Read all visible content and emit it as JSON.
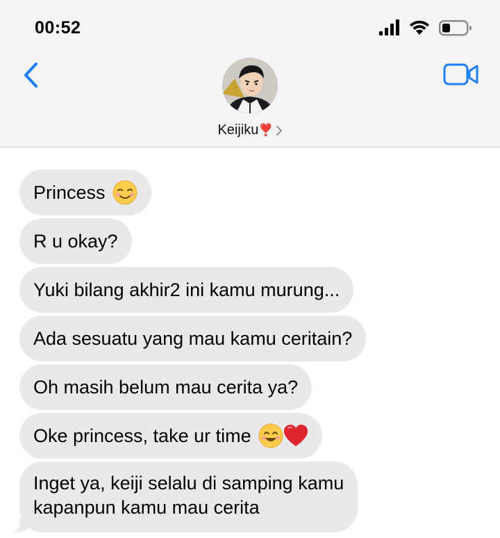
{
  "status_bar": {
    "time": "00:52",
    "icons": [
      "cellular-signal-icon",
      "wifi-icon",
      "battery-icon"
    ]
  },
  "nav": {
    "back_icon": "chevron-left-icon",
    "video_icon": "video-camera-icon",
    "accent_color": "#1a7ef5"
  },
  "contact": {
    "name": "Keijiku",
    "name_emoji": "❣️",
    "chevron_icon": "chevron-right-icon"
  },
  "messages": [
    {
      "text": "Princess",
      "emoji": "relaxed-face-emoji"
    },
    {
      "text": "R u okay?"
    },
    {
      "text": "Yuki bilang akhir2 ini kamu murung..."
    },
    {
      "text": "Ada sesuatu yang mau kamu ceritain?"
    },
    {
      "text": "Oh masih belum mau cerita ya?"
    },
    {
      "text": "Oke princess, take ur time",
      "emoji": "smiling-face-and-red-heart-emoji"
    },
    {
      "line1": "Inget ya, keiji selalu di samping kamu",
      "line2": "kapanpun kamu mau cerita"
    }
  ],
  "colors": {
    "bubble_bg": "#e9e9eb",
    "header_bg": "#f4f4f6"
  }
}
